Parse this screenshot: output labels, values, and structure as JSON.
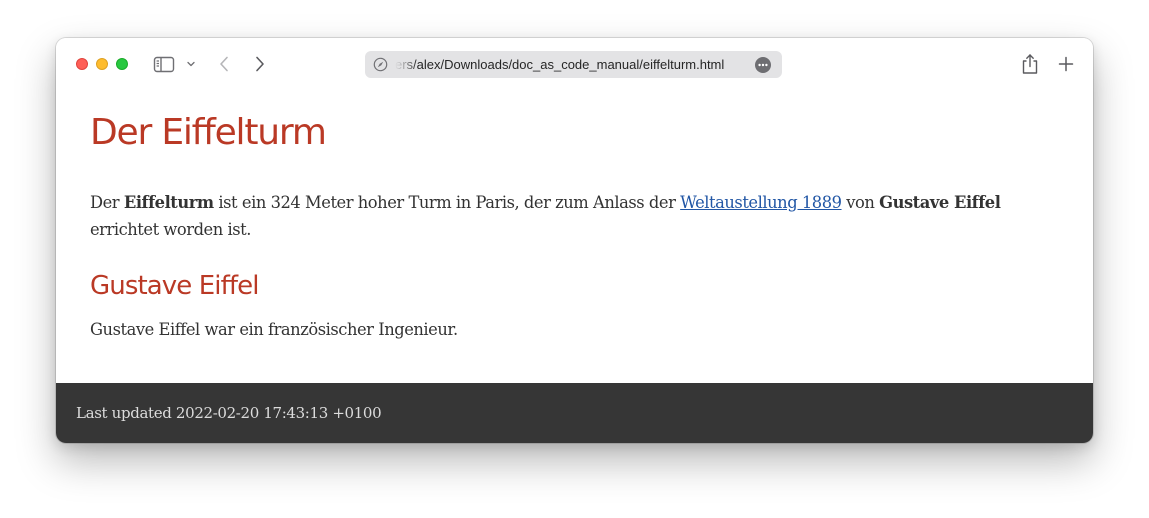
{
  "browser": {
    "url_text": "ers/alex/Downloads/doc_as_code_manual/eiffelturm.html",
    "icons": {
      "close": "close-window",
      "minimize": "minimize-window",
      "maximize": "maximize-window",
      "sidebar": "sidebar-icon",
      "sidebar_menu": "chevron-down-icon",
      "back": "chevron-left-icon",
      "forward": "chevron-right-icon",
      "site_info": "compass-icon",
      "page_menu": "more-icon",
      "share": "share-icon",
      "new_tab": "plus-icon"
    },
    "colors": {
      "close": "#fe5f57",
      "minimize": "#febc2e",
      "maximize": "#28c840"
    }
  },
  "page": {
    "title": "Der Eiffelturm",
    "intro": {
      "t1": "Der ",
      "b1": "Eiffelturm",
      "t2": " ist ein 324 Meter hoher Turm in Paris, der zum Anlass der ",
      "link": "Weltaustellung 1889",
      "t3": " von ",
      "b2": "Gustave Eiffel",
      "t4": " errichtet worden ist."
    },
    "section_title": "Gustave Eiffel",
    "section_text": "Gustave Eiffel war ein französischer Ingenieur.",
    "footer": "Last updated 2022-02-20 17:43:13 +0100",
    "colors": {
      "heading": "#ba3925",
      "link": "#2156a5",
      "text": "#333333",
      "footer_bg": "#363636"
    }
  }
}
